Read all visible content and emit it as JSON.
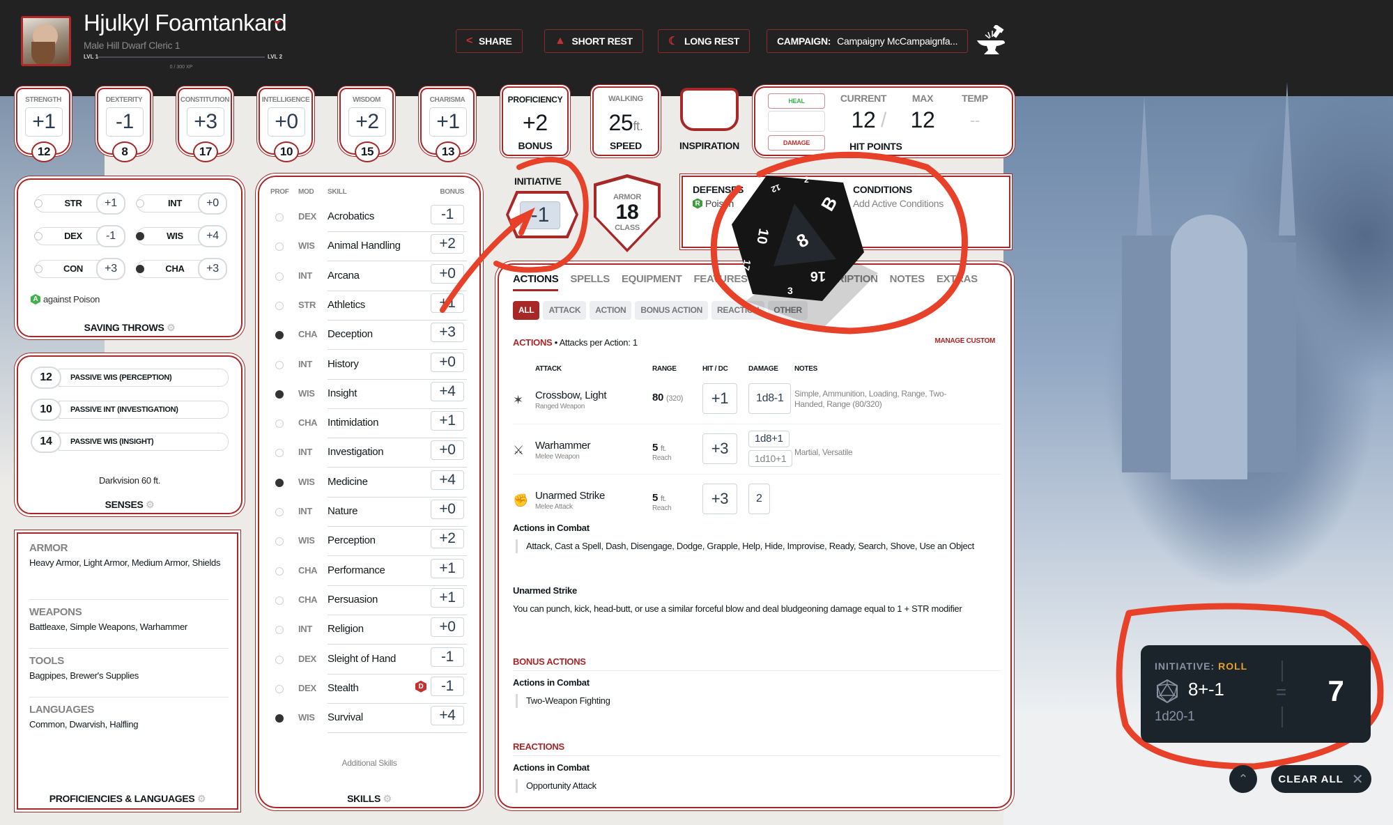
{
  "header": {
    "character_name": "Hjulkyl Foamtankard",
    "subtitle": "Male  Hill Dwarf  Cleric 1",
    "level_current": "LVL 1",
    "level_next": "LVL 2",
    "xp_text": "0 / 300 XP",
    "xp_progress": 0,
    "buttons": {
      "share": "SHARE",
      "short_rest": "SHORT REST",
      "long_rest": "LONG REST",
      "campaign_label": "CAMPAIGN:",
      "campaign_value": "Campaigny McCampaignfa..."
    }
  },
  "abilities": [
    {
      "name": "STRENGTH",
      "mod": "+1",
      "score": "12"
    },
    {
      "name": "DEXTERITY",
      "mod": "-1",
      "score": "8"
    },
    {
      "name": "CONSTITUTION",
      "mod": "+3",
      "score": "17"
    },
    {
      "name": "INTELLIGENCE",
      "mod": "+0",
      "score": "10"
    },
    {
      "name": "WISDOM",
      "mod": "+2",
      "score": "15"
    },
    {
      "name": "CHARISMA",
      "mod": "+1",
      "score": "13"
    }
  ],
  "proficiency": {
    "top": "PROFICIENCY",
    "value": "+2",
    "bottom": "BONUS"
  },
  "speed": {
    "top": "WALKING",
    "value": "25",
    "unit": "ft.",
    "bottom": "SPEED"
  },
  "inspiration": {
    "label": "INSPIRATION"
  },
  "hit_points": {
    "heal_label": "HEAL",
    "damage_label": "DAMAGE",
    "current_label": "CURRENT",
    "max_label": "MAX",
    "temp_label": "TEMP",
    "current": "12",
    "max": "12",
    "temp": "--",
    "slash": "/",
    "title": "HIT POINTS"
  },
  "initiative": {
    "label": "INITIATIVE",
    "value": "-1"
  },
  "armor": {
    "top": "ARMOR",
    "value": "18",
    "bottom": "CLASS"
  },
  "defenses": {
    "title": "DEFENSES",
    "items": [
      {
        "badge": "R",
        "text": "Poison"
      }
    ]
  },
  "conditions": {
    "title": "CONDITIONS",
    "placeholder": "Add Active Conditions"
  },
  "saving_throws": {
    "title": "SAVING THROWS",
    "items": [
      {
        "ability": "STR",
        "value": "+1",
        "proficient": false
      },
      {
        "ability": "INT",
        "value": "+0",
        "proficient": false
      },
      {
        "ability": "DEX",
        "value": "-1",
        "proficient": false
      },
      {
        "ability": "WIS",
        "value": "+4",
        "proficient": true
      },
      {
        "ability": "CON",
        "value": "+3",
        "proficient": false
      },
      {
        "ability": "CHA",
        "value": "+3",
        "proficient": true
      }
    ],
    "advantage_badge": "A",
    "advantage_note": "against Poison"
  },
  "senses": {
    "title": "SENSES",
    "items": [
      {
        "value": "12",
        "label": "PASSIVE WIS (PERCEPTION)"
      },
      {
        "value": "10",
        "label": "PASSIVE INT (INVESTIGATION)"
      },
      {
        "value": "14",
        "label": "PASSIVE WIS (INSIGHT)"
      }
    ],
    "darkvision": "Darkvision 60 ft."
  },
  "proficiencies": {
    "title": "PROFICIENCIES & LANGUAGES",
    "sections": [
      {
        "heading": "ARMOR",
        "value": "Heavy Armor, Light Armor, Medium Armor, Shields"
      },
      {
        "heading": "WEAPONS",
        "value": "Battleaxe, Simple Weapons, Warhammer"
      },
      {
        "heading": "TOOLS",
        "value": "Bagpipes, Brewer's Supplies"
      },
      {
        "heading": "LANGUAGES",
        "value": "Common, Dwarvish, Halfling"
      }
    ]
  },
  "skills": {
    "headers": {
      "prof": "PROF",
      "mod": "MOD",
      "skill": "SKILL",
      "bonus": "BONUS"
    },
    "items": [
      {
        "mod": "DEX",
        "name": "Acrobatics",
        "bonus": "-1",
        "proficient": false
      },
      {
        "mod": "WIS",
        "name": "Animal Handling",
        "bonus": "+2",
        "proficient": false
      },
      {
        "mod": "INT",
        "name": "Arcana",
        "bonus": "+0",
        "proficient": false
      },
      {
        "mod": "STR",
        "name": "Athletics",
        "bonus": "+1",
        "proficient": false
      },
      {
        "mod": "CHA",
        "name": "Deception",
        "bonus": "+3",
        "proficient": true
      },
      {
        "mod": "INT",
        "name": "History",
        "bonus": "+0",
        "proficient": false
      },
      {
        "mod": "WIS",
        "name": "Insight",
        "bonus": "+4",
        "proficient": true
      },
      {
        "mod": "CHA",
        "name": "Intimidation",
        "bonus": "+1",
        "proficient": false
      },
      {
        "mod": "INT",
        "name": "Investigation",
        "bonus": "+0",
        "proficient": false
      },
      {
        "mod": "WIS",
        "name": "Medicine",
        "bonus": "+4",
        "proficient": true
      },
      {
        "mod": "INT",
        "name": "Nature",
        "bonus": "+0",
        "proficient": false
      },
      {
        "mod": "WIS",
        "name": "Perception",
        "bonus": "+2",
        "proficient": false
      },
      {
        "mod": "CHA",
        "name": "Performance",
        "bonus": "+1",
        "proficient": false
      },
      {
        "mod": "CHA",
        "name": "Persuasion",
        "bonus": "+1",
        "proficient": false
      },
      {
        "mod": "INT",
        "name": "Religion",
        "bonus": "+0",
        "proficient": false
      },
      {
        "mod": "DEX",
        "name": "Sleight of Hand",
        "bonus": "-1",
        "proficient": false
      },
      {
        "mod": "DEX",
        "name": "Stealth",
        "bonus": "-1",
        "proficient": false,
        "disadvantage": "D"
      },
      {
        "mod": "WIS",
        "name": "Survival",
        "bonus": "+4",
        "proficient": true
      }
    ],
    "additional": "Additional Skills",
    "title": "SKILLS"
  },
  "actions_panel": {
    "tabs": [
      "ACTIONS",
      "SPELLS",
      "EQUIPMENT",
      "FEATURES & TRAITS",
      "DESCRIPTION",
      "NOTES",
      "EXTRAS"
    ],
    "active_tab": "ACTIONS",
    "filters": [
      "ALL",
      "ATTACK",
      "ACTION",
      "BONUS ACTION",
      "REACTION",
      "OTHER"
    ],
    "active_filter": "ALL",
    "actions_heading": "ACTIONS",
    "attacks_per_action": "• Attacks per Action: 1",
    "manage_custom": "MANAGE CUSTOM",
    "attack_headers": {
      "attack": "ATTACK",
      "range": "RANGE",
      "hit": "HIT / DC",
      "damage": "DAMAGE",
      "notes": "NOTES"
    },
    "attacks": [
      {
        "name": "Crossbow, Light",
        "type": "Ranged Weapon",
        "range": "80",
        "range_long": "(320)",
        "range_sub": "",
        "hit": "+1",
        "damage": "1d8-1",
        "damage_alt": "",
        "notes": "Simple, Ammunition, Loading, Range, Two-Handed, Range (80/320)"
      },
      {
        "name": "Warhammer",
        "type": "Melee Weapon",
        "range": "5",
        "range_long": "ft.",
        "range_sub": "Reach",
        "hit": "+3",
        "damage": "1d8+1",
        "damage_alt": "1d10+1",
        "notes": "Martial, Versatile"
      },
      {
        "name": "Unarmed Strike",
        "type": "Melee Attack",
        "range": "5",
        "range_long": "ft.",
        "range_sub": "Reach",
        "hit": "+3",
        "damage": "2",
        "damage_alt": "",
        "notes": ""
      }
    ],
    "actions_in_combat_title": "Actions in Combat",
    "actions_in_combat": "Attack, Cast a Spell, Dash, Disengage, Dodge, Grapple, Help, Hide, Improvise, Ready, Search, Shove, Use an Object",
    "unarmed_title": "Unarmed Strike",
    "unarmed_text": "You can punch, kick, head-butt, or use a similar forceful blow and deal bludgeoning damage equal to 1 + STR modifier",
    "bonus_heading": "BONUS ACTIONS",
    "bonus_title": "Actions in Combat",
    "bonus_text": "Two-Weapon Fighting",
    "reactions_heading": "REACTIONS",
    "reactions_title": "Actions in Combat",
    "reactions_text": "Opportunity Attack"
  },
  "dice_overlay": {
    "faces": [
      "8",
      "10",
      "16",
      "17",
      "3",
      "B",
      "12",
      "2"
    ]
  },
  "roll_result": {
    "label": "INITIATIVE:",
    "type": "ROLL",
    "expression": "8+-1",
    "notation": "1d20-1",
    "equals": "=",
    "total": "7"
  },
  "roll_controls": {
    "clear_all": "CLEAR ALL"
  },
  "colors": {
    "accent": "#a82727",
    "roll_type": "#e8a128",
    "annotation": "#e8412a",
    "topbar": "#222222"
  }
}
